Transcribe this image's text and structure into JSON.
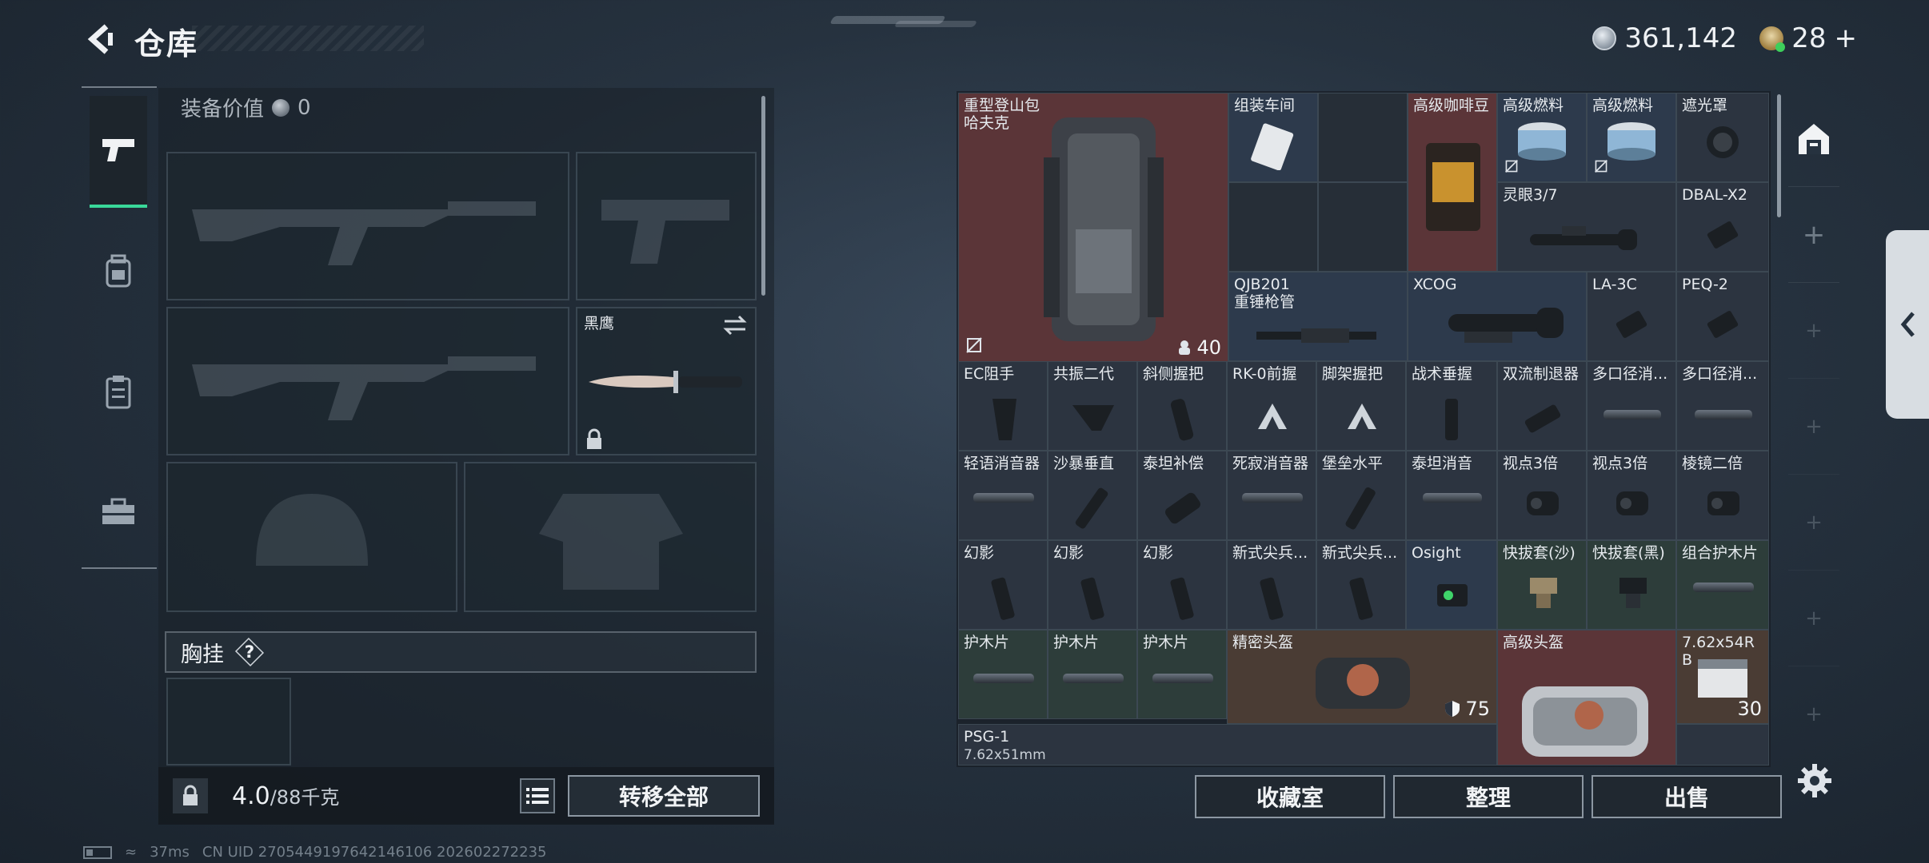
{
  "header": {
    "title": "仓库",
    "coins": "361,142",
    "tickets": "28",
    "tickets_plus": "+"
  },
  "left_nav": [
    {
      "name": "weapons",
      "icon": "pistol-icon",
      "active": true
    },
    {
      "name": "gear",
      "icon": "backpack-icon"
    },
    {
      "name": "clipboard",
      "icon": "clipboard-icon"
    },
    {
      "name": "toolbox",
      "icon": "toolbox-icon"
    }
  ],
  "loadout": {
    "equip_value_label": "装备价值",
    "equip_value": "0",
    "melee_name": "黑鹰",
    "chest_label": "胸挂",
    "help": "?",
    "weight_value": "4.0",
    "weight_max": "/88千克",
    "transfer_all": "转移全部"
  },
  "grid": {
    "backpack": {
      "name": "重型登山包",
      "sub": "哈夫克",
      "count": "40"
    },
    "cells": {
      "c_zuzhuang": "组装车间",
      "c_coffee": "高级咖啡豆",
      "c_fuel1": "高级燃料",
      "c_fuel2": "高级燃料",
      "c_shade": "遮光罩",
      "c_lingyan": "灵眼3/7",
      "c_dbal": "DBAL-X2",
      "c_qjb_1": "QJB201",
      "c_qjb_2": "重锤枪管",
      "c_xcog": "XCOG",
      "c_la3c": "LA-3C",
      "c_peq2": "PEQ-2",
      "r3_1": "EC阻手",
      "r3_2": "共振二代",
      "r3_3": "斜侧握把",
      "r3_4": "RK-0前握",
      "r3_5": "脚架握把",
      "r3_6": "战术垂握",
      "r3_7": "双流制退器",
      "r3_8": "多口径消...",
      "r3_9": "多口径消...",
      "r4_1": "轻语消音器",
      "r4_2": "沙暴垂直",
      "r4_3": "泰坦补偿",
      "r4_4": "死寂消音器",
      "r4_5": "堡垒水平",
      "r4_6": "泰坦消音",
      "r4_7": "视点3倍",
      "r4_8": "视点3倍",
      "r4_9": "棱镜二倍",
      "r5_1": "幻影",
      "r5_2": "幻影",
      "r5_3": "幻影",
      "r5_4": "新式尖兵...",
      "r5_5": "新式尖兵...",
      "r5_6": "Osight",
      "r5_7": "快拔套(沙)",
      "r5_8": "快拔套(黑)",
      "r5_9": "组合护木片",
      "r6_1": "护木片",
      "r6_2": "护木片",
      "r6_3": "护木片",
      "helmet1": "精密头盔",
      "helmet1_val": "75",
      "helmet2": "高级头盔",
      "ammo_1": "7.62x54R",
      "ammo_2": "B",
      "ammo_count": "30",
      "psg_1": "PSG-1",
      "psg_2": "7.62x51mm"
    }
  },
  "bottom_buttons": {
    "collection": "收藏室",
    "organize": "整理",
    "sell": "出售"
  },
  "status": {
    "ping": "37ms",
    "uid": "CN UID 2705449197642146106 202602272235"
  },
  "colors": {
    "accent": "#39d89a",
    "rare_red": "#5b3538",
    "rare_green": "#2d3d3a",
    "rare_blue": "#2d3a4c"
  }
}
